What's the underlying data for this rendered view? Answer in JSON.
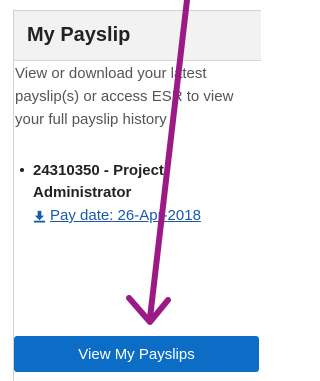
{
  "panel": {
    "title": "My Payslip",
    "description": "View or download your latest payslip(s) or access ESR to view your full payslip history"
  },
  "payslips": [
    {
      "job": "24310350 - Project Administrator",
      "pay_date_label": "Pay date: 26-Apr-2018",
      "icon": "download-icon"
    }
  ],
  "actions": {
    "view_button_label": "View My Payslips"
  },
  "colors": {
    "link": "#1a5aa8",
    "button_bg": "#0b6dc6",
    "annotation_arrow": "#9c1a86"
  },
  "icons": [
    "download-icon",
    "annotation-arrow"
  ]
}
